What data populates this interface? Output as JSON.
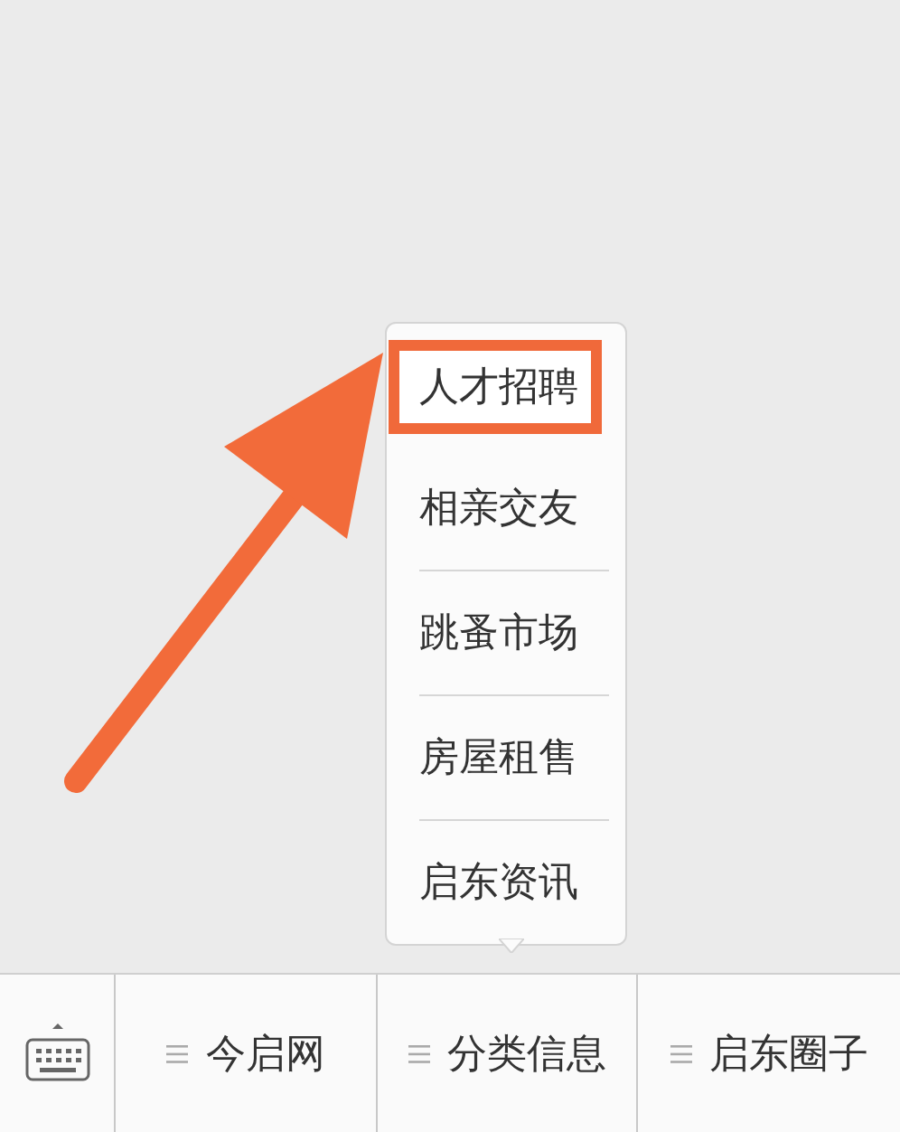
{
  "popup_menu": {
    "items": [
      {
        "label": "人才招聘",
        "highlighted": true
      },
      {
        "label": "相亲交友",
        "highlighted": false
      },
      {
        "label": "跳蚤市场",
        "highlighted": false
      },
      {
        "label": "房屋租售",
        "highlighted": false
      },
      {
        "label": "启东资讯",
        "highlighted": false
      }
    ]
  },
  "bottom_menu": {
    "items": [
      {
        "label": "今启网"
      },
      {
        "label": "分类信息"
      },
      {
        "label": "启东圈子"
      }
    ]
  }
}
